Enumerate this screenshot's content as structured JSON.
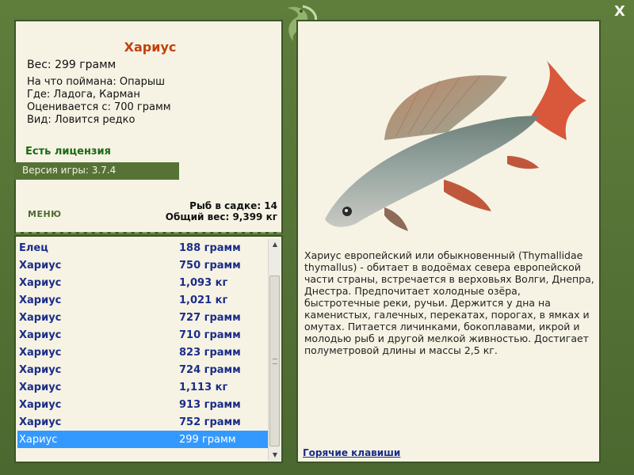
{
  "fish": {
    "title": "Хариус",
    "weight": "Вес: 299 грамм",
    "bait": "На что поймана: Опарыш",
    "location": "Где: Ладога, Карман",
    "value": "Оценивается с: 700 грамм",
    "rarity": "Вид: Ловится редко"
  },
  "license": "Есть лицензия",
  "version": "Версия игры: 3.7.4",
  "menu_label": "МЕНЮ",
  "cage": {
    "count": "Рыб в садке: 14",
    "total": "Общий вес: 9,399 кг"
  },
  "catches": [
    {
      "name": "Елец",
      "weight": "188 грамм"
    },
    {
      "name": "Хариус",
      "weight": "750 грамм"
    },
    {
      "name": "Хариус",
      "weight": "1,093 кг"
    },
    {
      "name": "Хариус",
      "weight": "1,021 кг"
    },
    {
      "name": "Хариус",
      "weight": "727 грамм"
    },
    {
      "name": "Хариус",
      "weight": "710 грамм"
    },
    {
      "name": "Хариус",
      "weight": "823 грамм"
    },
    {
      "name": "Хариус",
      "weight": "724 грамм"
    },
    {
      "name": "Хариус",
      "weight": "1,113 кг"
    },
    {
      "name": "Хариус",
      "weight": "913 грамм"
    },
    {
      "name": "Хариус",
      "weight": "752 грамм"
    },
    {
      "name": "Хариус",
      "weight": "299 грамм",
      "selected": true
    }
  ],
  "description": "Хариус европейский или обыкновенный (Thymallidae thymallus) - обитает в водоёмах севера европейской части страны, встречается в верховьях Волги, Днепра, Днестра. Предпочитает холодные озёра, быстротечные реки, ручьи. Держится у дна на каменистых, галечных, перекатах, порогах, в ямках и омутах. Питается личинками, бокоплавами, икрой и молодью рыб и другой мелкой живностью. Достигает полуметровой длины и массы 2,5 кг.",
  "hotkeys_label": "Горячие клавиши",
  "close_label": "X",
  "icons": {
    "close": "close-icon",
    "ornament": "fish-ornament-icon",
    "scroll_up": "scroll-up-arrow-icon",
    "scroll_down": "scroll-down-arrow-icon"
  },
  "colors": {
    "frame": "#4e6a32",
    "panel": "#f6f3e4",
    "title": "#c2410c",
    "list_text": "#1b2d8a",
    "selected": "#3399ff",
    "license": "#1a6a12"
  }
}
